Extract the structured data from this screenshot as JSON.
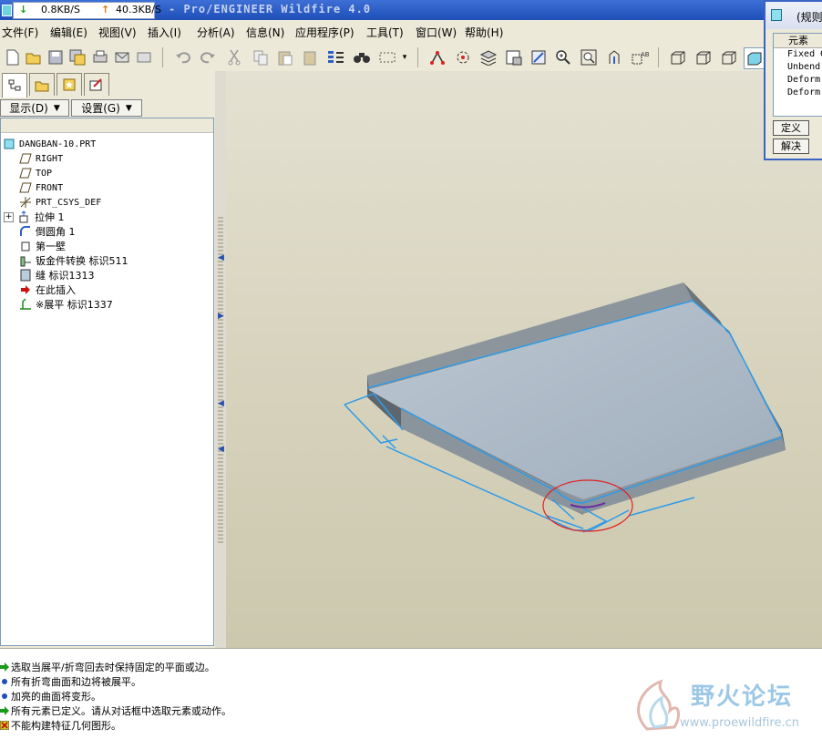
{
  "titlebar": {
    "download_speed": "0.8KB/S",
    "upload_speed": "40.3KB/S",
    "title": "- Pro/ENGINEER Wildfire 4.0"
  },
  "menubar": {
    "items": [
      "文件(F)",
      "编辑(E)",
      "视图(V)",
      "插入(I)",
      "分析(A)",
      "信息(N)",
      "应用程序(P)",
      "工具(T)",
      "窗口(W)",
      "帮助(H)"
    ]
  },
  "panel": {
    "show_label": "显示(D)",
    "settings_label": "设置(G)"
  },
  "tree": {
    "root": "DANGBAN-10.PRT",
    "items": [
      {
        "label": "RIGHT"
      },
      {
        "label": "TOP"
      },
      {
        "label": "FRONT"
      },
      {
        "label": "PRT_CSYS_DEF"
      },
      {
        "label": "拉伸 1"
      },
      {
        "label": "倒圆角 1"
      },
      {
        "label": "第一壁"
      },
      {
        "label": "钣金件转换 标识511"
      },
      {
        "label": "缝 标识1313"
      },
      {
        "label": "在此插入"
      },
      {
        "label": "※展平 标识1337"
      }
    ]
  },
  "dialog": {
    "title": "(规则",
    "column_header": "元素",
    "rows": [
      "Fixed G",
      "Unbend",
      "Deform",
      "Deform"
    ],
    "define_label": "定义",
    "solve_label": "解决"
  },
  "messages": [
    "选取当展平/折弯回去时保持固定的平面或边。",
    "所有折弯曲面和边将被展平。",
    "加亮的曲面将变形。",
    "所有元素已定义。请从对话框中选取元素或动作。",
    "不能构建特征几何图形。"
  ],
  "watermark": {
    "name": "野火论坛",
    "url": "www.proewildfire.cn"
  },
  "colors": {
    "titlebar": "#1f4fb8",
    "highlight_edges": "#2e9be8",
    "annotation_circle": "#e02020",
    "model_surface": "#a9b6c2"
  }
}
